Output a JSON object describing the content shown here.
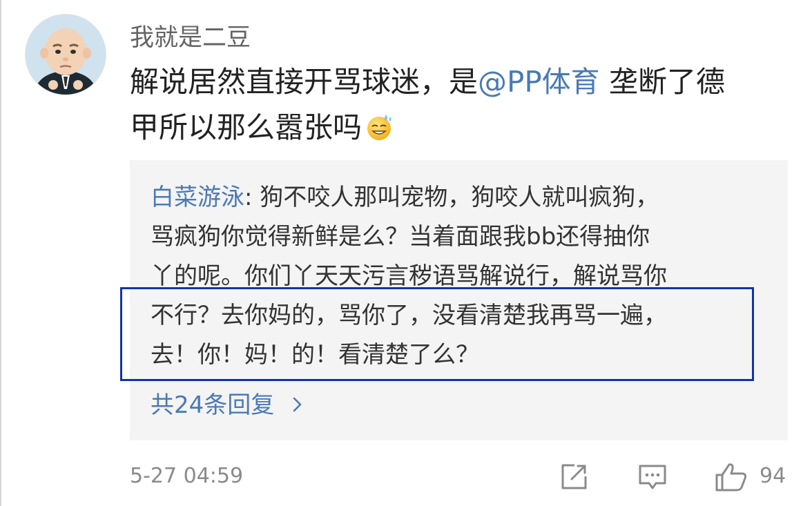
{
  "comment": {
    "username": "我就是二豆",
    "text_part1": "解说居然直接开骂球迷，是",
    "mention": "@PP体育",
    "text_part2": " 垄断了德",
    "text_line2": "甲所以那么嚣张吗",
    "emoji_icon": "sweat-smile-emoji-icon",
    "timestamp": "5-27 04:59",
    "like_count": "94"
  },
  "reply": {
    "author": "白菜游泳",
    "separator": ": ",
    "line1": "狗不咬人那叫宠物，狗咬人就叫疯狗，",
    "line2": "骂疯狗你觉得新鲜是么？当着面跟我bb还得抽你",
    "line3": "丫的呢。你们丫天天污言秽语骂解说行，解说骂你",
    "line4": "不行？去你妈的，骂你了，没看清楚我再骂一遍，",
    "line5": "去！你！妈！的！看清楚了么？",
    "more_label": "共24条回复",
    "more_icon": "chevron-right-icon"
  },
  "actions": {
    "share_icon": "share-icon",
    "comment_icon": "comment-icon",
    "like_icon": "thumbs-up-icon"
  },
  "colors": {
    "link": "#4a79b5",
    "highlight_border": "#1034a6",
    "reply_background": "#f4f4f4"
  }
}
